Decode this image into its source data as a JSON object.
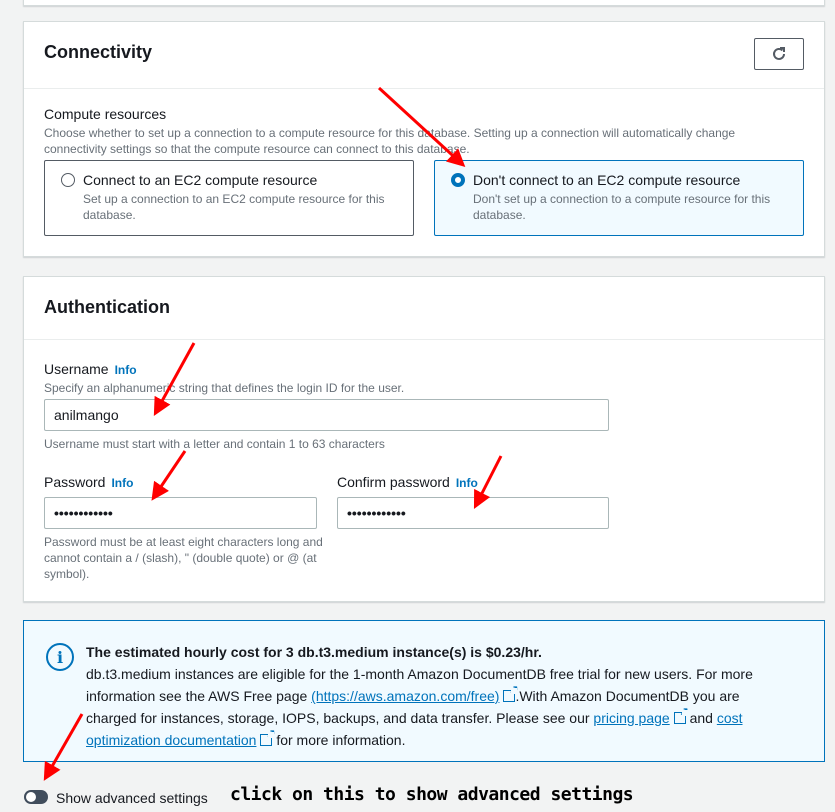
{
  "connectivity": {
    "title": "Connectivity",
    "compute_label": "Compute resources",
    "compute_desc": "Choose whether to set up a connection to a compute resource for this database. Setting up a connection will automatically change connectivity settings so that the compute resource can connect to this database.",
    "options": [
      {
        "title": "Connect to an EC2 compute resource",
        "desc": "Set up a connection to an EC2 compute resource for this database.",
        "selected": false
      },
      {
        "title": "Don't connect to an EC2 compute resource",
        "desc": "Don't set up a connection to a compute resource for this database.",
        "selected": true
      }
    ],
    "refresh_icon": "refresh-icon"
  },
  "authentication": {
    "title": "Authentication",
    "username_label": "Username",
    "info": "Info",
    "username_desc": "Specify an alphanumeric string that defines the login ID for the user.",
    "username_value": "anilmango",
    "username_hint": "Username must start with a letter and contain 1 to 63 characters",
    "password_label": "Password",
    "password_value": "••••••••••••",
    "password_hint": "Password must be at least eight characters long and cannot contain a / (slash), \" (double quote) or @ (at symbol).",
    "confirm_label": "Confirm password",
    "confirm_value": "••••••••••••"
  },
  "alert": {
    "icon": "info-icon",
    "title": "The estimated hourly cost for 3 db.t3.medium instance(s) is $0.23/hr.",
    "text1": "db.t3.medium instances are eligible for the 1-month Amazon DocumentDB free trial for new users. For more information see the AWS Free page ",
    "link_free": "(https://aws.amazon.com/free)",
    "text2": ".With Amazon DocumentDB you are charged for instances, storage, IOPS, backups, and data transfer. Please see our ",
    "link_pricing": "pricing page",
    "text3": " and ",
    "link_cost": "cost optimization documentation",
    "text4": " for more information."
  },
  "advanced": {
    "toggle_label": "Show advanced settings",
    "enabled": false
  },
  "annotation": {
    "text": "click on this to show advanced settings",
    "arrow_color": "#ff0000"
  }
}
